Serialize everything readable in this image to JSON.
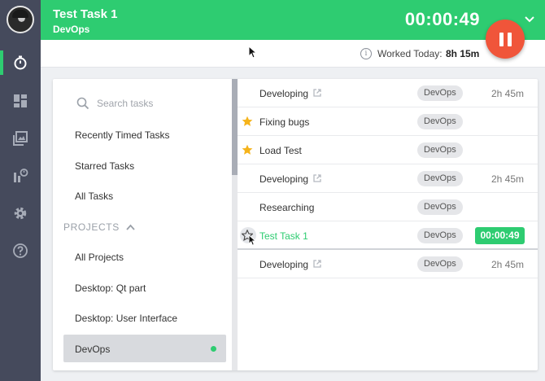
{
  "header": {
    "task_title": "Test Task 1",
    "project": "DevOps",
    "timer": "00:00:49"
  },
  "worked_today": {
    "label": "Worked Today:",
    "value": "8h 15m"
  },
  "sidebar_nav": [
    "avatar",
    "timer-icon",
    "dashboard-icon",
    "screenshots-icon",
    "reports-icon",
    "gear-icon",
    "help-icon"
  ],
  "search": {
    "placeholder": "Search tasks"
  },
  "menu": {
    "recent": "Recently Timed Tasks",
    "starred": "Starred Tasks",
    "all": "All Tasks"
  },
  "projects": {
    "heading": "PROJECTS",
    "items": [
      "All Projects",
      "Desktop: Qt part",
      "Desktop: User Interface",
      "DevOps"
    ]
  },
  "tasks": [
    {
      "name": "Developing",
      "tag": "DevOps",
      "duration": "2h 45m",
      "starred": false,
      "external": true
    },
    {
      "name": "Fixing bugs",
      "tag": "DevOps",
      "duration": "",
      "starred": true,
      "external": false
    },
    {
      "name": "Load Test",
      "tag": "DevOps",
      "duration": "",
      "starred": true,
      "external": false
    },
    {
      "name": "Developing",
      "tag": "DevOps",
      "duration": "2h 45m",
      "starred": false,
      "external": true
    },
    {
      "name": "Researching",
      "tag": "DevOps",
      "duration": "",
      "starred": false,
      "external": false
    },
    {
      "name": "Test Task 1",
      "tag": "DevOps",
      "duration": "00:00:49",
      "starred": false,
      "external": false,
      "active": true
    },
    {
      "name": "Developing",
      "tag": "DevOps",
      "duration": "2h 45m",
      "starred": false,
      "external": true
    }
  ],
  "colors": {
    "accent": "#2ecc71",
    "pause": "#f0553a",
    "rail": "#454a5c",
    "star": "#f5b31b"
  }
}
